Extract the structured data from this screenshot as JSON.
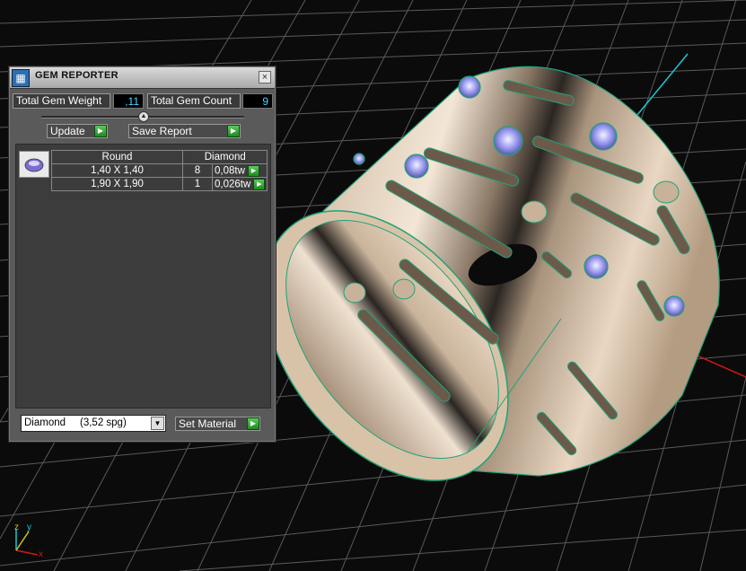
{
  "panel": {
    "title": "GEM REPORTER",
    "close_glyph": "×",
    "total_weight_label": "Total Gem Weight",
    "total_weight_value": ",11",
    "total_count_label": "Total Gem Count",
    "total_count_value": "9",
    "update_label": "Update",
    "save_report_label": "Save Report",
    "table": {
      "headers": [
        "Round",
        "Diamond"
      ],
      "rows": [
        {
          "size": "1,40 X 1,40",
          "count": "8",
          "weight": "0,08tw"
        },
        {
          "size": "1,90 X 1,90",
          "count": "1",
          "weight": "0,026tw"
        }
      ]
    },
    "material_select_value": "Diamond     (3,52 spg)",
    "set_material_label": "Set Material"
  },
  "viewport": {
    "axis_labels": {
      "x": "x",
      "y": "y",
      "z": "z"
    },
    "colors": {
      "grid": "#5a5a5a",
      "ring": "#d9c3a8",
      "ring_edge": "#1fa37a",
      "gem": "#b8b8ff",
      "x_axis": "#d21818",
      "y_axis": "#18c7d2"
    }
  }
}
